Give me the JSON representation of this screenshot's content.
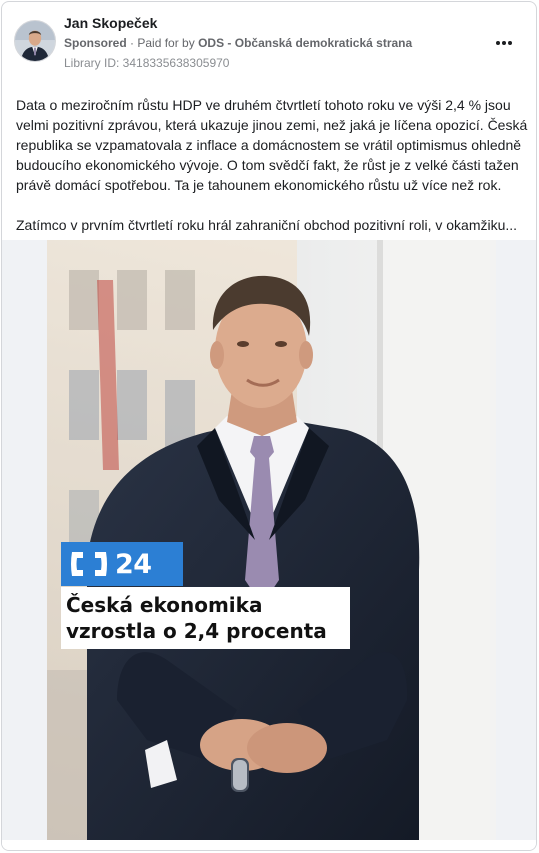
{
  "post": {
    "author": "Jan Skopeček",
    "sponsored_label": "Sponsored",
    "paid_for_prefix": "Paid for by",
    "payer": "ODS - Občanská demokratická strana",
    "library_id": "Library ID: 3418335638305970",
    "more_icon": "more-horizontal-icon",
    "text_paragraph_1": "Data o meziročním růstu HDP ve druhém čtvrtletí tohoto roku ve výši 2,4 % jsou velmi pozitivní zprávou, která ukazuje jinou zemi, než jaká je líčena opozicí. Česká republika se vzpamatovala z inflace a domácnostem se vrátil optimismus ohledně budoucího ekonomického vývoje. O tom svědčí fakt, že růst je z velké části tažen právě domácí spotřebou. Ta je tahounem ekonomického růstu už více než rok.",
    "text_paragraph_2": "Zatímco v prvním čtvrtletí roku hrál zahraniční obchod pozitivní roli, v okamžiku..."
  },
  "creative": {
    "channel_number": "24",
    "headline_line_1": "Česká ekonomika",
    "headline_line_2": "vzrostla o 2,4 procenta"
  },
  "colors": {
    "logo_blue": "#2c7fd4",
    "suit": "#1e2533",
    "tie": "#9a8bb0",
    "background_wall": "#e8e9ea"
  }
}
